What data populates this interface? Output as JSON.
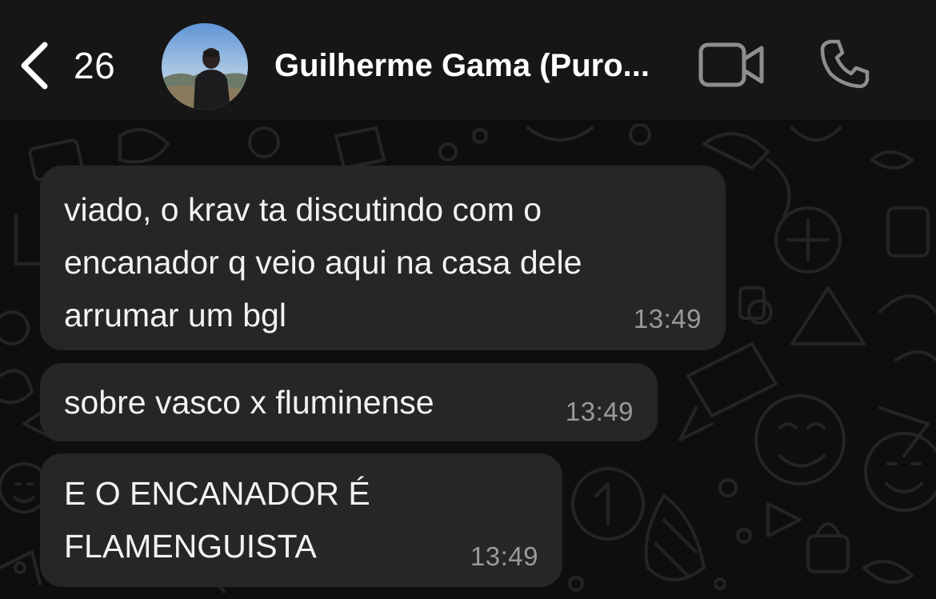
{
  "header": {
    "back_count": "26",
    "contact_name": "Guilherme Gama (Puro...",
    "icons": {
      "back": "chevron-left-icon",
      "video": "video-camera-icon",
      "call": "phone-icon"
    }
  },
  "messages": [
    {
      "text": "viado, o krav ta discutindo com o\nencanador q veio aqui na casa dele\narrumar um bgl",
      "time": "13:49",
      "direction": "incoming"
    },
    {
      "text": "sobre vasco x fluminense",
      "time": "13:49",
      "direction": "incoming"
    },
    {
      "text": "E O ENCANADOR É\nFLAMENGUISTA",
      "time": "13:49",
      "direction": "incoming"
    }
  ],
  "colors": {
    "header_bg": "#161616",
    "chat_bg": "#0e0e0e",
    "bubble_bg": "#262626",
    "text": "#f2f2f2",
    "timestamp": "#9a9a9a",
    "icon_gray": "#8e8e8e"
  }
}
